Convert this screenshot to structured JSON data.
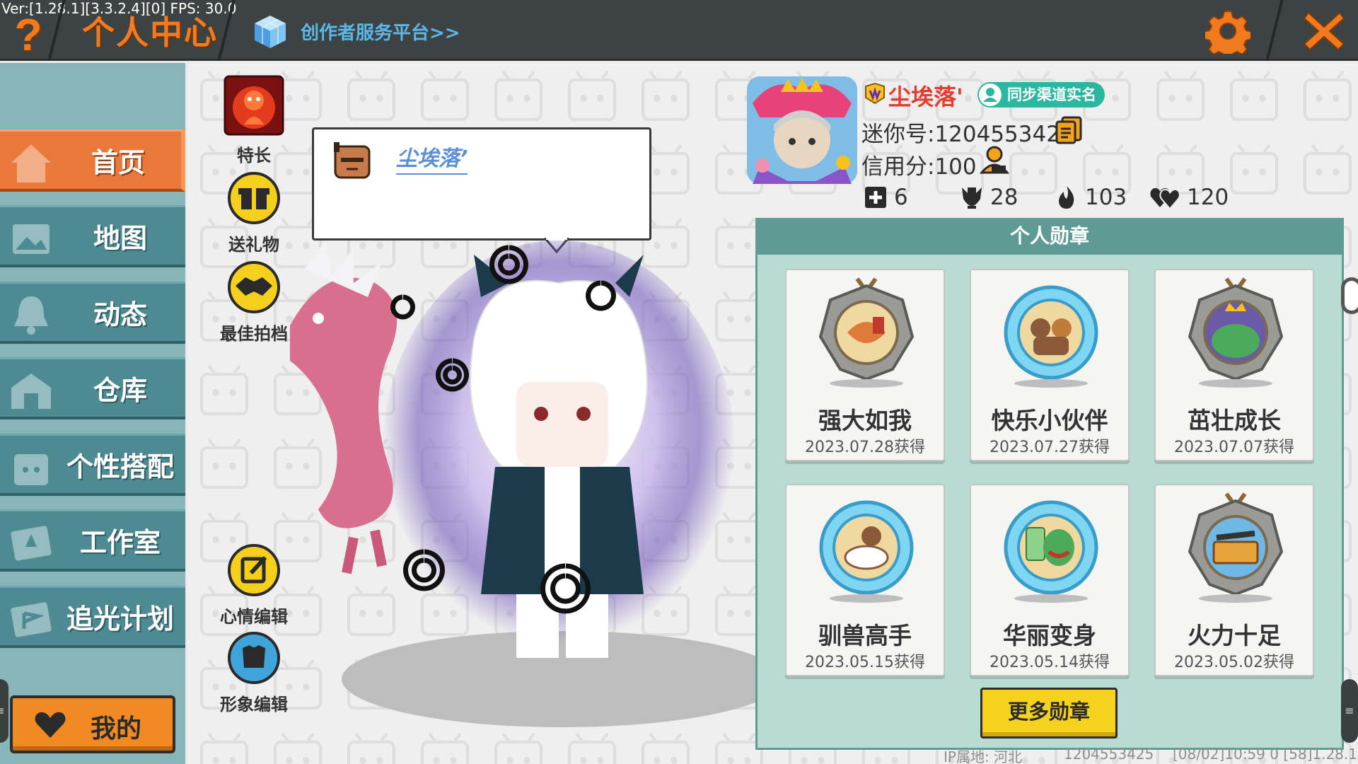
{
  "version": "Ver:[1.28.1][3.3.2.4][0] FPS: 30.0",
  "topbar": {
    "help": "?",
    "title": "个人中心",
    "creator_link": "创作者服务平台>>"
  },
  "nav": {
    "items": [
      {
        "label": "首页",
        "icon": "house-icon",
        "active": true
      },
      {
        "label": "地图",
        "icon": "picture-icon",
        "active": false
      },
      {
        "label": "动态",
        "icon": "bell-icon",
        "active": false
      },
      {
        "label": "仓库",
        "icon": "warehouse-icon",
        "active": false
      },
      {
        "label": "个性搭配",
        "icon": "outfit-icon",
        "active": false
      },
      {
        "label": "工作室",
        "icon": "studio-icon",
        "active": false
      },
      {
        "label": "追光计划",
        "icon": "flag-icon",
        "active": false
      }
    ],
    "mine": "我的"
  },
  "actions": {
    "specialty": "特长",
    "gift": "送礼物",
    "partner": "最佳拍档",
    "mood_edit": "心情编辑",
    "look_edit": "形象编辑"
  },
  "speech": {
    "name": "尘埃落’"
  },
  "profile": {
    "nickname": "尘埃落'",
    "realname_badge": "同步渠道实名",
    "mini_id": "迷你号:1204553425",
    "credit": "信用分:100",
    "stats": [
      {
        "icon": "plus-icon",
        "value": "6"
      },
      {
        "icon": "trophy-icon",
        "value": "28"
      },
      {
        "icon": "flame-icon",
        "value": "103"
      },
      {
        "icon": "hearts-icon",
        "value": "120"
      }
    ]
  },
  "medals": {
    "title": "个人勋章",
    "items": [
      {
        "name": "强大如我",
        "date": "2023.07.28获得",
        "style": "stone"
      },
      {
        "name": "快乐小伙伴",
        "date": "2023.07.27获得",
        "style": "crystal"
      },
      {
        "name": "茁壮成长",
        "date": "2023.07.07获得",
        "style": "stone"
      },
      {
        "name": "驯兽高手",
        "date": "2023.05.15获得",
        "style": "crystal"
      },
      {
        "name": "华丽变身",
        "date": "2023.05.14获得",
        "style": "crystal"
      },
      {
        "name": "火力十足",
        "date": "2023.05.02获得",
        "style": "stone"
      }
    ],
    "more": "更多勋章"
  },
  "footer": {
    "ip": "IP属地: 河北",
    "uid": "1204553425",
    "session": "[08/02]10:59 0  [58]1.28.1"
  },
  "colors": {
    "accent_orange": "#e8793a",
    "nav_teal": "#4d8a92",
    "panel_teal": "#5e9b95",
    "nickname_red": "#e43c2f",
    "button_yellow": "#f4d21e"
  }
}
